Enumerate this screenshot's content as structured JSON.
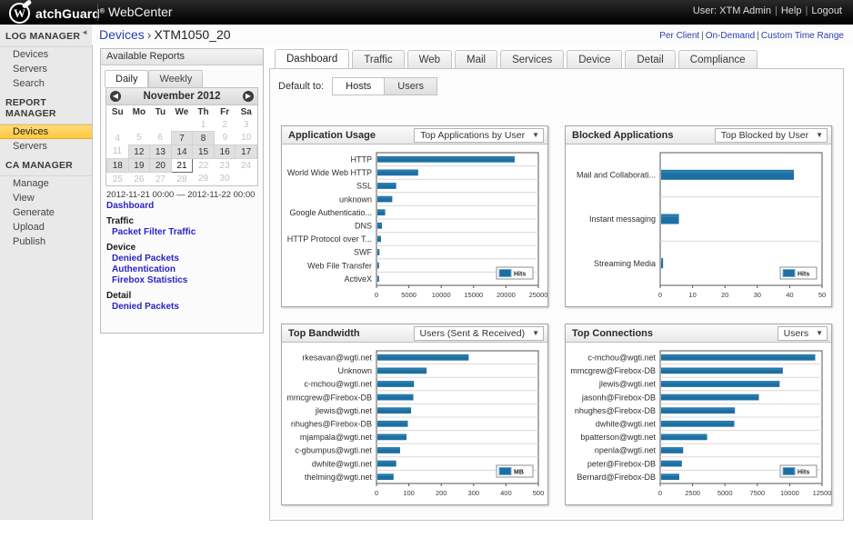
{
  "topbar": {
    "brand": "WatchGuard",
    "brand_letter": "W",
    "brand_rest": "atchGuard",
    "tm": "®",
    "product": "WebCenter",
    "user_label": "User: XTM Admin",
    "help": "Help",
    "logout": "Logout",
    "sep": "|"
  },
  "breadcrumb": {
    "root": "Devices",
    "arrow": "›",
    "current": "XTM1050_20",
    "links": [
      "Per Client",
      "On-Demand",
      "Custom Time Range"
    ],
    "link_sep": "|"
  },
  "sidebar": {
    "collapse_icon": "◄",
    "groups": [
      {
        "title": "LOG MANAGER",
        "items": [
          {
            "label": "Devices",
            "active": false
          },
          {
            "label": "Servers",
            "active": false
          },
          {
            "label": "Search",
            "active": false
          }
        ]
      },
      {
        "title": "REPORT MANAGER",
        "items": [
          {
            "label": "Devices",
            "active": true
          },
          {
            "label": "Servers",
            "active": false
          }
        ]
      },
      {
        "title": "CA MANAGER",
        "items": [
          {
            "label": "Manage",
            "active": false
          },
          {
            "label": "View",
            "active": false
          },
          {
            "label": "Generate",
            "active": false
          },
          {
            "label": "Upload",
            "active": false
          },
          {
            "label": "Publish",
            "active": false
          }
        ]
      }
    ]
  },
  "reports_panel": {
    "header": "Available Reports",
    "tabs": [
      {
        "label": "Daily",
        "selected": true
      },
      {
        "label": "Weekly",
        "selected": false
      }
    ],
    "calendar": {
      "prev_icon": "◀",
      "next_icon": "▶",
      "month_label": "November 2012",
      "weekdays": [
        "Su",
        "Mo",
        "Tu",
        "We",
        "Th",
        "Fr",
        "Sa"
      ],
      "weeks": [
        [
          {
            "d": "",
            "s": "blank"
          },
          {
            "d": "",
            "s": "blank"
          },
          {
            "d": "",
            "s": "blank"
          },
          {
            "d": "",
            "s": "blank"
          },
          {
            "d": "1",
            "s": "off"
          },
          {
            "d": "2",
            "s": "off"
          },
          {
            "d": "3",
            "s": "off"
          }
        ],
        [
          {
            "d": "4",
            "s": "off"
          },
          {
            "d": "5",
            "s": "off"
          },
          {
            "d": "6",
            "s": "off"
          },
          {
            "d": "7",
            "s": "on"
          },
          {
            "d": "8",
            "s": "on"
          },
          {
            "d": "9",
            "s": "off"
          },
          {
            "d": "10",
            "s": "off"
          }
        ],
        [
          {
            "d": "11",
            "s": "off"
          },
          {
            "d": "12",
            "s": "on"
          },
          {
            "d": "13",
            "s": "on"
          },
          {
            "d": "14",
            "s": "on"
          },
          {
            "d": "15",
            "s": "on"
          },
          {
            "d": "16",
            "s": "on"
          },
          {
            "d": "17",
            "s": "on"
          }
        ],
        [
          {
            "d": "18",
            "s": "on"
          },
          {
            "d": "19",
            "s": "on"
          },
          {
            "d": "20",
            "s": "on"
          },
          {
            "d": "21",
            "s": "sel"
          },
          {
            "d": "22",
            "s": "off"
          },
          {
            "d": "23",
            "s": "off"
          },
          {
            "d": "24",
            "s": "off"
          }
        ],
        [
          {
            "d": "25",
            "s": "off"
          },
          {
            "d": "26",
            "s": "off"
          },
          {
            "d": "27",
            "s": "off"
          },
          {
            "d": "28",
            "s": "off"
          },
          {
            "d": "29",
            "s": "off"
          },
          {
            "d": "30",
            "s": "off"
          },
          {
            "d": "",
            "s": "blank"
          }
        ]
      ]
    },
    "date_range": "2012-11-21 00:00 — 2012-11-22 00:00",
    "dashboard_link": "Dashboard",
    "sections": [
      {
        "category": "Traffic",
        "links": [
          "Packet Filter Traffic"
        ]
      },
      {
        "category": "Device",
        "links": [
          "Denied Packets",
          "Authentication",
          "Firebox Statistics"
        ]
      },
      {
        "category": "Detail",
        "links": [
          "Denied Packets"
        ]
      }
    ]
  },
  "main": {
    "tabs": [
      {
        "label": "Dashboard",
        "selected": true
      },
      {
        "label": "Traffic",
        "selected": false
      },
      {
        "label": "Web",
        "selected": false
      },
      {
        "label": "Mail",
        "selected": false
      },
      {
        "label": "Services",
        "selected": false
      },
      {
        "label": "Device",
        "selected": false
      },
      {
        "label": "Detail",
        "selected": false
      },
      {
        "label": "Compliance",
        "selected": false
      }
    ],
    "default_to_label": "Default to:",
    "default_to_options": [
      {
        "label": "Hosts",
        "selected": true
      },
      {
        "label": "Users",
        "selected": false
      }
    ]
  },
  "colors": {
    "bar": "#1d6fa1",
    "bar_light": "#3b8fc0",
    "accent_link": "#2b24c6",
    "sidebar_active": "#ffc93c",
    "plot_border": "#555555",
    "gridline": "#d8d8d8"
  },
  "chart_data": [
    {
      "id": "application-usage",
      "type": "bar",
      "orientation": "horizontal",
      "title": "Application Usage",
      "selector": "Top Applications by User",
      "legend": [
        "Hits"
      ],
      "legend_position": "bottom-right-inside",
      "xlabel": "",
      "ylabel": "",
      "xlim": [
        0,
        25000
      ],
      "xticks": [
        0,
        5000,
        10000,
        15000,
        20000,
        25000
      ],
      "grid": true,
      "categories": [
        "HTTP",
        "World Wide Web HTTP",
        "SSL",
        "unknown",
        "Google Authenticatio...",
        "DNS",
        "HTTP Protocol over T...",
        "SWF",
        "Web File Transfer",
        "ActiveX"
      ],
      "values": [
        21200,
        6300,
        2900,
        2300,
        1200,
        700,
        550,
        320,
        250,
        250
      ]
    },
    {
      "id": "blocked-applications",
      "type": "bar",
      "orientation": "horizontal",
      "title": "Blocked Applications",
      "selector": "Top Blocked by User",
      "legend": [
        "Hits"
      ],
      "legend_position": "bottom-right-inside",
      "xlabel": "",
      "ylabel": "",
      "xlim": [
        0,
        50
      ],
      "xticks": [
        0,
        10,
        20,
        30,
        40,
        50
      ],
      "grid": true,
      "categories": [
        "Mail and Collaborati...",
        "Instant messaging",
        "Streaming Media"
      ],
      "values": [
        41,
        5.5,
        0.6
      ]
    },
    {
      "id": "top-bandwidth",
      "type": "bar",
      "orientation": "horizontal",
      "title": "Top Bandwidth",
      "selector": "Users (Sent & Received)",
      "legend": [
        "MB"
      ],
      "legend_position": "bottom-right-inside",
      "xlabel": "",
      "ylabel": "",
      "xlim": [
        0,
        500
      ],
      "xticks": [
        0,
        100,
        200,
        300,
        400,
        500
      ],
      "grid": true,
      "categories": [
        "rkesavan@wgti.net",
        "Unknown",
        "c-mchou@wgti.net",
        "mmcgrew@Firebox-DB",
        "jlewis@wgti.net",
        "nhughes@Firebox-DB",
        "mjampala@wgti.net",
        "c-gbumpus@wgti.net",
        "dwhite@wgti.net",
        "thelming@wgti.net"
      ],
      "values": [
        282,
        152,
        113,
        111,
        104,
        94,
        90,
        70,
        58,
        50
      ]
    },
    {
      "id": "top-connections",
      "type": "bar",
      "orientation": "horizontal",
      "title": "Top Connections",
      "selector": "Users",
      "legend": [
        "Hits"
      ],
      "legend_position": "bottom-right-inside",
      "xlabel": "",
      "ylabel": "",
      "xlim": [
        0,
        12500
      ],
      "xticks": [
        0,
        2500,
        5000,
        7500,
        10000,
        12500
      ],
      "grid": true,
      "categories": [
        "c-mchou@wgti.net",
        "mmcgrew@Firebox-DB",
        "jlewis@wgti.net",
        "jasonh@Firebox-DB",
        "nhughes@Firebox-DB",
        "dwhite@wgti.net",
        "bpatterson@wgti.net",
        "npenla@wgti.net",
        "peter@Firebox-DB",
        "Bernard@Firebox-DB"
      ],
      "values": [
        11900,
        9400,
        9150,
        7550,
        5700,
        5650,
        3550,
        1700,
        1600,
        1400
      ]
    }
  ]
}
